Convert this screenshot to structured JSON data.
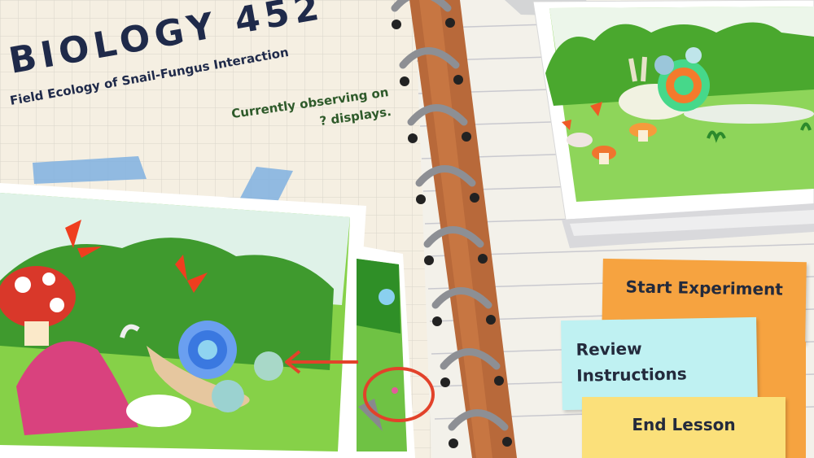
{
  "header": {
    "title": "BIOLOGY 452",
    "subtitle": "Field Ecology of Snail-Fungus Interaction",
    "status_line1": "Currently observing on",
    "status_line2": "? displays."
  },
  "menu": {
    "start_label": "Start Experiment",
    "review_label_line1": "Review",
    "review_label_line2": "Instructions",
    "end_label": "End Lesson"
  },
  "colors": {
    "paper": "#f5efe2",
    "grid": "#d9d5cb",
    "title": "#1f2a4a",
    "status": "#2e5a2a",
    "tape": "#7fb0e0",
    "spiral_cord": "#b8693a",
    "note_orange": "#f6a340",
    "note_cyan": "#bff1f2",
    "note_yellow": "#fbe07a",
    "grass": "#7cd44a",
    "red_circle": "#e2422a"
  },
  "icons": [
    "spiral-binding-icon",
    "snail-icon",
    "mushroom-icon",
    "red-arrow-icon"
  ]
}
